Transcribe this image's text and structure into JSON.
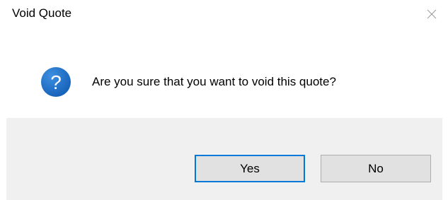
{
  "window": {
    "title": "Void Quote",
    "close_icon": "close-icon"
  },
  "message": {
    "icon": "question-icon",
    "icon_color": "#1f6fc5",
    "text": "Are you sure that you want to void this quote?"
  },
  "buttons": {
    "yes_label": "Yes",
    "no_label": "No",
    "default_focus_color": "#0078d7"
  }
}
